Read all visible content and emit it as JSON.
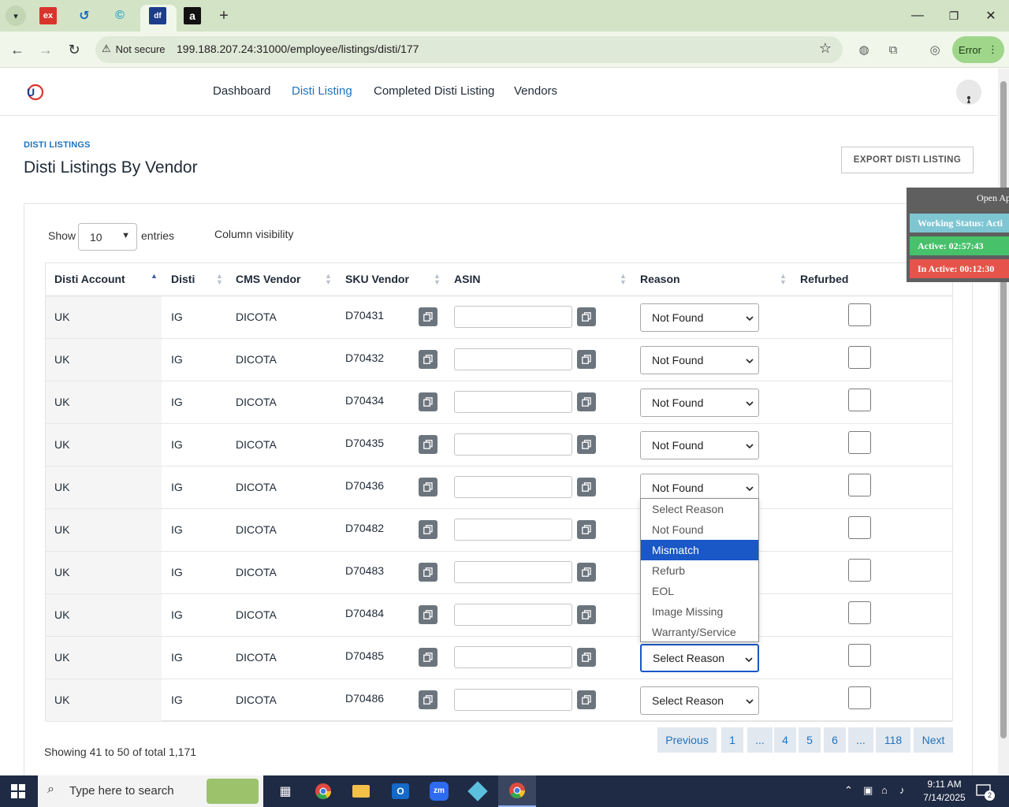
{
  "browser": {
    "url": "199.188.207.24:31000/employee/listings/disti/177",
    "security_label": "Not secure",
    "error_label": "Error",
    "tabs": [
      {
        "icon": "ex-favicon-icon"
      },
      {
        "icon": "tab2-favicon-icon"
      },
      {
        "icon": "tab3-favicon-icon"
      },
      {
        "icon": "df-favicon-icon",
        "active": true
      },
      {
        "icon": "amazon-favicon-icon"
      }
    ]
  },
  "nav": {
    "items": [
      {
        "label": "Dashboard",
        "active": false
      },
      {
        "label": "Disti Listing",
        "active": true
      },
      {
        "label": "Completed Disti Listing",
        "active": false
      },
      {
        "label": "Vendors",
        "active": false
      }
    ]
  },
  "page": {
    "breadcrumb": "DISTI LISTINGS",
    "title": "Disti Listings By Vendor",
    "export_label": "EXPORT DISTI LISTING"
  },
  "table_controls": {
    "show_label": "Show",
    "entries_value": "10",
    "entries_label": "entries",
    "column_visibility": "Column visibility"
  },
  "table": {
    "headers": [
      "Disti Account",
      "Disti",
      "CMS Vendor",
      "SKU Vendor",
      "ASIN",
      "Reason",
      "Refurbed"
    ],
    "rows": [
      {
        "account": "UK",
        "disti": "IG",
        "vendor": "DICOTA",
        "sku": "D70431",
        "asin": "",
        "reason": "Not Found",
        "refurbed": false
      },
      {
        "account": "UK",
        "disti": "IG",
        "vendor": "DICOTA",
        "sku": "D70432",
        "asin": "",
        "reason": "Not Found",
        "refurbed": false
      },
      {
        "account": "UK",
        "disti": "IG",
        "vendor": "DICOTA",
        "sku": "D70434",
        "asin": "",
        "reason": "Not Found",
        "refurbed": false
      },
      {
        "account": "UK",
        "disti": "IG",
        "vendor": "DICOTA",
        "sku": "D70435",
        "asin": "",
        "reason": "Not Found",
        "refurbed": false
      },
      {
        "account": "UK",
        "disti": "IG",
        "vendor": "DICOTA",
        "sku": "D70436",
        "asin": "",
        "reason": "Not Found",
        "refurbed": false
      },
      {
        "account": "UK",
        "disti": "IG",
        "vendor": "DICOTA",
        "sku": "D70482",
        "asin": "",
        "reason": "",
        "refurbed": false
      },
      {
        "account": "UK",
        "disti": "IG",
        "vendor": "DICOTA",
        "sku": "D70483",
        "asin": "",
        "reason": "",
        "refurbed": false
      },
      {
        "account": "UK",
        "disti": "IG",
        "vendor": "DICOTA",
        "sku": "D70484",
        "asin": "",
        "reason": "",
        "refurbed": false
      },
      {
        "account": "UK",
        "disti": "IG",
        "vendor": "DICOTA",
        "sku": "D70485",
        "asin": "",
        "reason": "Select Reason",
        "refurbed": false
      },
      {
        "account": "UK",
        "disti": "IG",
        "vendor": "DICOTA",
        "sku": "D70486",
        "asin": "",
        "reason": "Select Reason",
        "refurbed": false
      }
    ]
  },
  "reason_dropdown": {
    "options": [
      "Select Reason",
      "Not Found",
      "Mismatch",
      "Refurb",
      "EOL",
      "Image Missing",
      "Warranty/Service"
    ],
    "highlighted": "Mismatch"
  },
  "pagination": {
    "info": "Showing 41 to 50 of total 1,171",
    "previous": "Previous",
    "pages": [
      "1",
      "...",
      "4",
      "5",
      "6",
      "...",
      "118"
    ],
    "next": "Next"
  },
  "timer": {
    "open_label": "Open Ap",
    "working_status": "Working Status: Acti",
    "active": "Active: 02:57:43",
    "inactive": "In Active: 00:12:30",
    "colors": {
      "working": "#7fc6d3",
      "active": "#47c16a",
      "inactive": "#e5534b"
    }
  },
  "taskbar": {
    "search_placeholder": "Type here to search",
    "time": "9:11 AM",
    "date": "7/14/2025",
    "notifications": "2"
  },
  "colors": {
    "accent": "#1e73be",
    "dropdown_highlight": "#1a57c7",
    "copy_button": "#6c757d"
  }
}
